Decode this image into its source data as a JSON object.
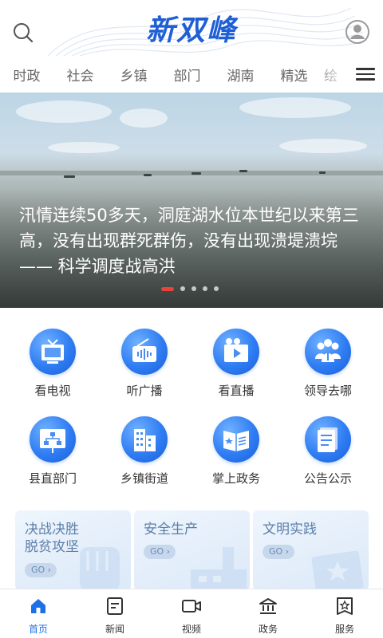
{
  "header": {
    "logo_text": "新双峰",
    "search_icon": "search-icon",
    "profile_icon": "user-avatar-icon"
  },
  "tabs": [
    {
      "label": "时政"
    },
    {
      "label": "社会"
    },
    {
      "label": "乡镇"
    },
    {
      "label": "部门"
    },
    {
      "label": "湖南"
    },
    {
      "label": "精选"
    },
    {
      "label": "绘"
    }
  ],
  "tabs_menu_icon": "hamburger-menu-icon",
  "banner": {
    "title": "汛情连续50多天，洞庭湖水位本世纪以来第三高，没有出现群死群伤，没有出现溃堤溃垸—— 科学调度战高洪",
    "active_slide": 1,
    "slide_count": 5
  },
  "grid": [
    {
      "label": "看电视",
      "icon": "tv-icon"
    },
    {
      "label": "听广播",
      "icon": "radio-icon"
    },
    {
      "label": "看直播",
      "icon": "live-video-icon"
    },
    {
      "label": "领导去哪",
      "icon": "leaders-icon"
    },
    {
      "label": "县直部门",
      "icon": "org-chart-icon"
    },
    {
      "label": "乡镇街道",
      "icon": "buildings-icon"
    },
    {
      "label": "掌上政务",
      "icon": "government-book-icon"
    },
    {
      "label": "公告公示",
      "icon": "notice-document-icon"
    }
  ],
  "cards": [
    {
      "title_line1": "决战决胜",
      "title_line2": "脱贫攻坚",
      "go": "GO"
    },
    {
      "title_line1": "安全生产",
      "title_line2": "",
      "go": "GO"
    },
    {
      "title_line1": "文明实践",
      "title_line2": "",
      "go": "GO"
    }
  ],
  "bottom_nav": [
    {
      "label": "首页",
      "icon": "home-icon",
      "active": true
    },
    {
      "label": "新闻",
      "icon": "news-icon",
      "active": false
    },
    {
      "label": "视频",
      "icon": "video-camera-icon",
      "active": false
    },
    {
      "label": "政务",
      "icon": "government-building-icon",
      "active": false
    },
    {
      "label": "服务",
      "icon": "service-star-icon",
      "active": false
    }
  ],
  "colors": {
    "brand_blue": "#1f6fe8",
    "active_dot": "#e8423a"
  }
}
